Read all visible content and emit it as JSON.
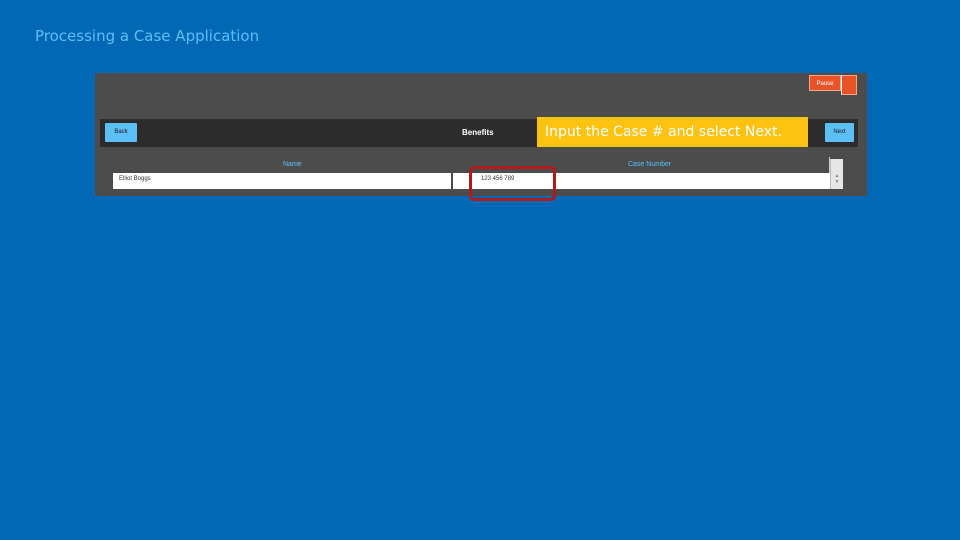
{
  "slide": {
    "title": "Processing a Case Application"
  },
  "app": {
    "pause_label": "Pause",
    "back_label": "Back",
    "next_label": "Next",
    "page_heading": "Benefits",
    "columns": [
      "Name",
      "Case Number"
    ],
    "row": {
      "name": "Elliot Boggs",
      "case_number": "123 456 789"
    }
  },
  "callout": {
    "text": "Input the Case # and select Next."
  },
  "colors": {
    "background": "#0068b4",
    "accent": "#5bc0f7",
    "callout": "#ffc20e",
    "highlight": "#b11b1b",
    "pause": "#e8542a"
  },
  "icons": {
    "scroll_up": "chevron-up-icon",
    "scroll_down": "chevron-down-icon"
  }
}
